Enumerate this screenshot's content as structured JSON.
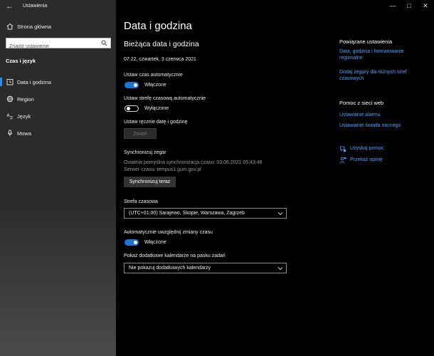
{
  "app": {
    "title": "Ustawienia"
  },
  "sidebar": {
    "home_label": "Strona główna",
    "search_placeholder": "Znajdź ustawienie",
    "section_label": "Czas i język",
    "items": [
      {
        "label": "Data i godzina",
        "icon": "clock-icon",
        "selected": true
      },
      {
        "label": "Region",
        "icon": "globe-icon",
        "selected": false
      },
      {
        "label": "Język",
        "icon": "language-icon",
        "selected": false
      },
      {
        "label": "Mowa",
        "icon": "microphone-icon",
        "selected": false
      }
    ]
  },
  "main": {
    "title": "Data i godzina",
    "current_heading": "Bieżąca data i godzina",
    "current_datetime": "07:22, czwartek, 3 czerwca 2021",
    "auto_time": {
      "label": "Ustaw czas automatycznie",
      "state": "Włączone",
      "on": true
    },
    "auto_timezone": {
      "label": "Ustaw strefę czasową automatycznie",
      "state": "Wyłączone",
      "on": false
    },
    "manual": {
      "label": "Ustaw ręcznie datę i godzinę",
      "button": "Zmień"
    },
    "sync": {
      "heading": "Synchronizuj zegar",
      "last_sync": "Ostatnia pomyślna synchronizacja czasu: 03.06.2021 05:43:48",
      "server": "Serwer czasu: tempus1.gum.gov.pl",
      "button": "Synchronizuj teraz"
    },
    "timezone": {
      "label": "Strefa czasowa",
      "value": "(UTC+01:00) Sarajewo, Skopie, Warszawa, Zagrzeb"
    },
    "dst": {
      "label": "Automatycznie uwzględnij zmiany czasu",
      "state": "Włączone",
      "on": true
    },
    "calendars": {
      "label": "Pokaż dodatkowe kalendarze na pasku zadań",
      "value": "Nie pokazuj dodatkowych kalendarzy"
    }
  },
  "related": {
    "heading": "Powiązane ustawienia",
    "links": [
      "Data, godzina i formatowanie regionalne",
      "Dodaj zegary dla różnych stref czasowych"
    ]
  },
  "web_help": {
    "heading": "Pomoc z sieci web",
    "links": [
      "Ustawianie alarmu",
      "Ustawianie światła nocnego"
    ]
  },
  "feedback": {
    "help": "Uzyskaj pomoc",
    "feedback": "Przekaż opinię"
  },
  "colors": {
    "accent": "#1a76d2",
    "link": "#4aa3ff",
    "background": "#000000"
  }
}
